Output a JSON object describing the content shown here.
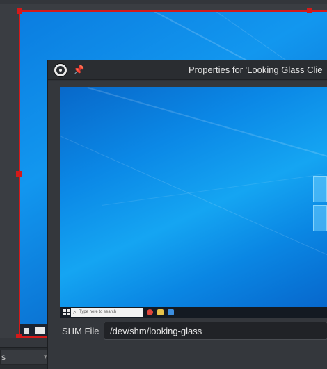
{
  "dialog": {
    "title": "Properties for 'Looking Glass Clie",
    "pin_glyph": "📌"
  },
  "preview": {
    "taskbar_search_placeholder": "Type here to search",
    "search_glyph": "⌕"
  },
  "shm_field": {
    "label": "SHM File",
    "value": "/dev/shm/looking-glass"
  },
  "docks": {
    "item_label": "s",
    "arrow_glyph": "▾"
  },
  "colors": {
    "selection_red": "#d41a1a",
    "dialog_bg": "#34373c",
    "windows_blue": "#0b88e6"
  }
}
